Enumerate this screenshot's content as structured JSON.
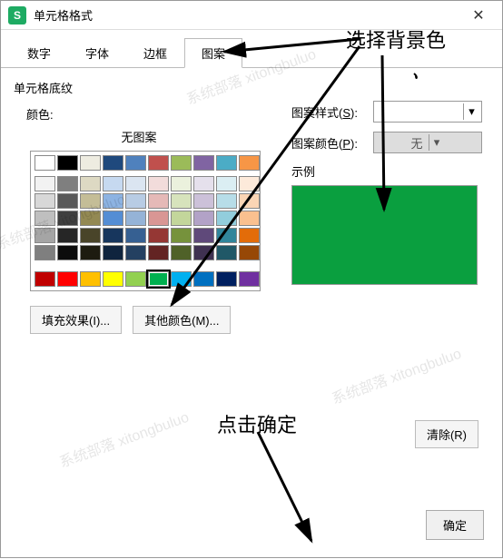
{
  "title": "单元格格式",
  "app_icon_text": "S",
  "tabs": {
    "t1": "数字",
    "t2": "字体",
    "t3": "边框",
    "t4": "图案"
  },
  "section": "单元格底纹",
  "color_label": "颜色:",
  "swatch_title": "无图案",
  "right": {
    "pattern_style_label": "图案样式(",
    "pattern_style_key": "S",
    "pattern_style_suffix": "):",
    "pattern_color_label": "图案颜色(",
    "pattern_color_key": "P",
    "pattern_color_suffix": "):",
    "pattern_color_value": "无",
    "sample_label": "示例",
    "sample_color": "#0a9f3f"
  },
  "buttons": {
    "fill_effect": "填充效果(I)...",
    "other_color": "其他颜色(M)...",
    "clear": "清除(R)",
    "ok": "确定"
  },
  "annotations": {
    "a1": "选择背景色",
    "a2": "点击确定"
  },
  "palette_top": [
    "#ffffff",
    "#000000",
    "#eeece1",
    "#1f497d",
    "#4f81bd",
    "#c0504d",
    "#9bbb59",
    "#8064a2",
    "#4bacc6",
    "#f79646"
  ],
  "palette_mid": [
    "#f2f2f2",
    "#7f7f7f",
    "#ddd9c3",
    "#c6d9f0",
    "#dbe5f1",
    "#f2dcdb",
    "#ebf1dd",
    "#e5e0ec",
    "#dbeef3",
    "#fdeada",
    "#d8d8d8",
    "#595959",
    "#c4bd97",
    "#8db3e2",
    "#b8cce4",
    "#e5b9b7",
    "#d7e3bc",
    "#ccc1d9",
    "#b7dde8",
    "#fbd5b5",
    "#bfbfbf",
    "#3f3f3f",
    "#938953",
    "#548dd4",
    "#95b3d7",
    "#d99694",
    "#c3d69b",
    "#b2a2c7",
    "#92cddc",
    "#fac08f",
    "#a5a5a5",
    "#262626",
    "#494429",
    "#17365d",
    "#366092",
    "#953734",
    "#76923c",
    "#5f497a",
    "#31859b",
    "#e36c09",
    "#7f7f7f",
    "#0c0c0c",
    "#1d1b10",
    "#0f243e",
    "#244061",
    "#632423",
    "#4f6128",
    "#3f3151",
    "#205867",
    "#974806"
  ],
  "palette_std": [
    "#c00000",
    "#ff0000",
    "#ffc000",
    "#ffff00",
    "#92d050",
    "#00b050",
    "#00b0f0",
    "#0070c0",
    "#002060",
    "#7030a0"
  ],
  "selected_color_index": 5
}
